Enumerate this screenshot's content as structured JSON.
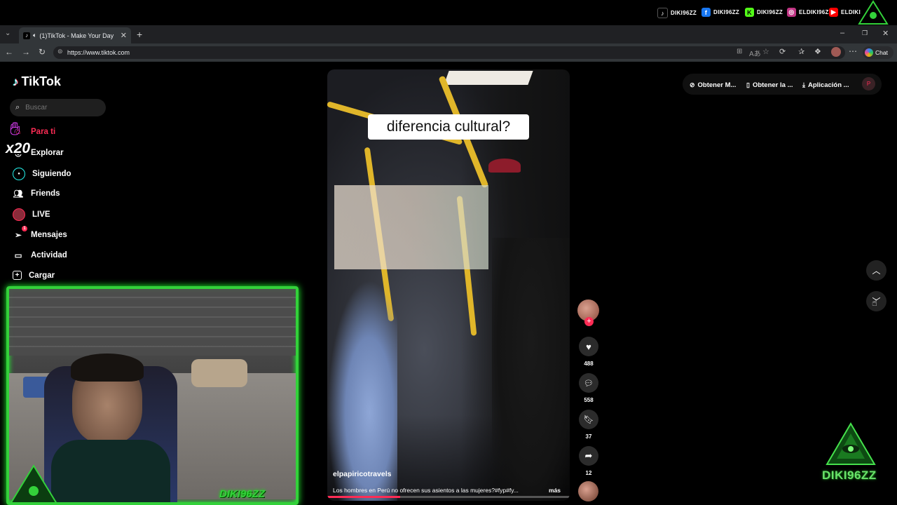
{
  "stream_socials": [
    {
      "icon": "tiktok-icon",
      "label": "DIKI96ZZ",
      "color": "#ffffff"
    },
    {
      "icon": "facebook-icon",
      "label": "DIKI96ZZ",
      "color": "#1877f2"
    },
    {
      "icon": "kick-icon",
      "label": "DIKI96ZZ",
      "color": "#53fc18"
    },
    {
      "icon": "instagram-icon",
      "label": "ELDIKI96ZZ",
      "color": "#c13584"
    },
    {
      "icon": "youtube-icon",
      "label": "ELDIKI",
      "color": "#ff0000"
    }
  ],
  "browser": {
    "tab_title": "(1)TikTok - Make Your Day",
    "url": "https://www.tiktok.com",
    "chat_label": "Chat"
  },
  "tiktok": {
    "logo_text": "TikTok",
    "search_placeholder": "Buscar",
    "nav": [
      {
        "label": "Para ti",
        "icon": "home-icon",
        "active": true
      },
      {
        "label": "Explorar",
        "icon": "compass-icon"
      },
      {
        "label": "Siguiendo",
        "icon": "following-avatar-icon"
      },
      {
        "label": "Friends",
        "icon": "friends-icon"
      },
      {
        "label": "LIVE",
        "icon": "live-avatar-icon"
      },
      {
        "label": "Mensajes",
        "icon": "messages-icon",
        "badge": "1"
      },
      {
        "label": "Actividad",
        "icon": "activity-icon"
      },
      {
        "label": "Cargar",
        "icon": "upload-icon"
      }
    ],
    "header_buttons": [
      "Obtener M...",
      "Obtener la ...",
      "Aplicación ..."
    ],
    "profile_initial": "P",
    "video": {
      "caption_overlay": "diferencia cultural?",
      "author": "elpapiricotravels",
      "description": "Los hombres en Perú no ofrecen sus asientos a las mujeres?#fyp#fy...",
      "more_label": "más",
      "progress": 0.3
    },
    "actions": {
      "likes": "488",
      "comments": "558",
      "saves": "37",
      "shares": "12"
    }
  },
  "overlay": {
    "multiplier": "x20",
    "brand": "DIKI96ZZ",
    "webcam_tag": "DIKI96ZZ"
  },
  "colors": {
    "tiktok_red": "#fe2c55",
    "neon_green": "#33d13a"
  }
}
